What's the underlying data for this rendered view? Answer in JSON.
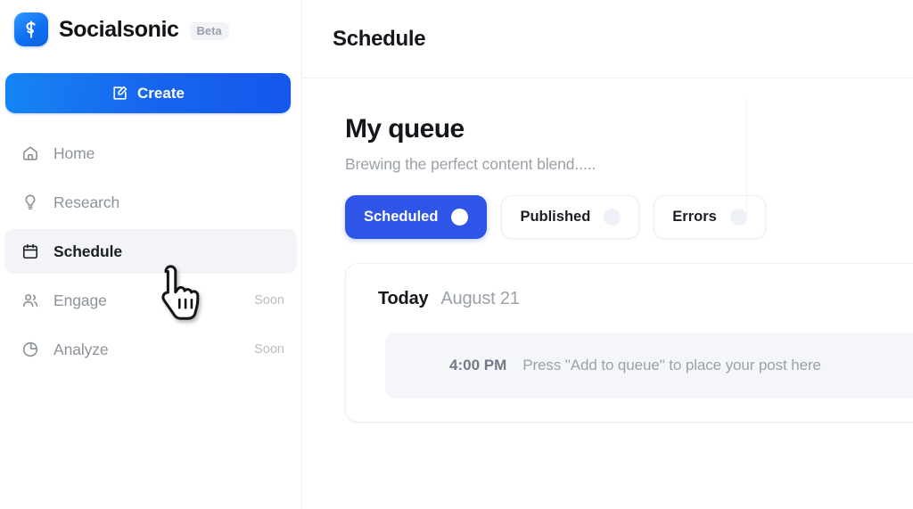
{
  "sidebar": {
    "brand": {
      "logo_icon": "socialsonic-s-logo-icon",
      "name": "Socialsonic",
      "badge": "Beta"
    },
    "create_button": {
      "label": "Create",
      "icon": "edit-square-pencil-icon"
    },
    "items": [
      {
        "label": "Home",
        "icon": "home-icon",
        "badge": "",
        "active": false
      },
      {
        "label": "Research",
        "icon": "lightbulb-icon",
        "badge": "",
        "active": false
      },
      {
        "label": "Schedule",
        "icon": "calendar-icon",
        "badge": "",
        "active": true
      },
      {
        "label": "Engage",
        "icon": "users-icon",
        "badge": "Soon",
        "active": false
      },
      {
        "label": "Analyze",
        "icon": "pie-chart-icon",
        "badge": "Soon",
        "active": false
      }
    ]
  },
  "header": {
    "title": "Schedule"
  },
  "queue": {
    "title": "My queue",
    "subtitle": "Brewing the perfect content blend.....",
    "tabs": [
      {
        "label": "Scheduled",
        "active": true
      },
      {
        "label": "Published",
        "active": false
      },
      {
        "label": "Errors",
        "active": false
      }
    ],
    "day": {
      "today_label": "Today",
      "date": "August 21"
    },
    "slots": [
      {
        "time": "4:00 PM",
        "hint": "Press \"Add to queue\" to place your post here"
      }
    ]
  },
  "cursor": {
    "icon": "pointing-hand-cursor-icon"
  },
  "colors": {
    "accent_blue": "#2f55e8",
    "create_blue": "#1767ef",
    "text_dark": "#14171c",
    "text_muted": "#9ba1a9",
    "sidebar_active_bg": "#f2f4f8",
    "slot_bg": "#f4f6fa"
  }
}
